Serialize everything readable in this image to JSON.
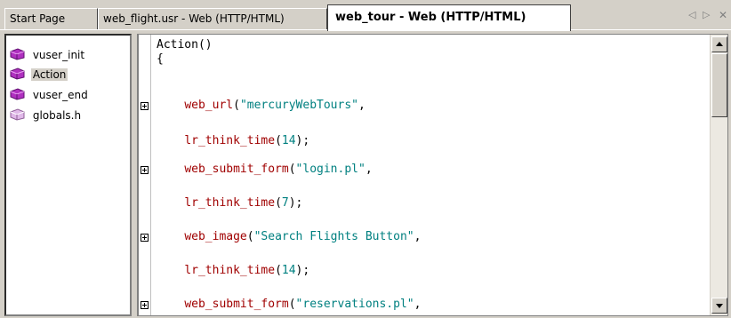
{
  "tabs": [
    {
      "label": "Start Page"
    },
    {
      "label": "web_flight.usr - Web (HTTP/HTML)"
    },
    {
      "label": "web_tour - Web (HTTP/HTML)"
    }
  ],
  "active_tab": 2,
  "nav": {
    "prev_icon": "triangle-left-icon",
    "next_icon": "triangle-right-icon",
    "close_icon": "close-icon"
  },
  "tree": {
    "items": [
      {
        "label": "vuser_init",
        "icon": "script-file-icon"
      },
      {
        "label": "Action",
        "icon": "script-file-icon",
        "selected": true
      },
      {
        "label": "vuser_end",
        "icon": "script-file-icon"
      },
      {
        "label": "globals.h",
        "icon": "header-file-icon"
      }
    ]
  },
  "editor": {
    "colors": {
      "function": "#a00000",
      "string": "#008080",
      "default": "#000000"
    },
    "lines": [
      {
        "text": "Action()"
      },
      {
        "text": "{"
      },
      {
        "fn": "web_url",
        "args": "\"mercuryWebTours\"",
        "tail": ",",
        "foldable": true
      },
      {
        "fn": "lr_think_time",
        "args": "14",
        "tail": ");",
        "foldable": false
      },
      {
        "fn": "web_submit_form",
        "args": "\"login.pl\"",
        "tail": ",",
        "foldable": true
      },
      {
        "fn": "lr_think_time",
        "args": "7",
        "tail": ");",
        "foldable": false
      },
      {
        "fn": "web_image",
        "args": "\"Search Flights Button\"",
        "tail": ",",
        "foldable": true
      },
      {
        "fn": "lr_think_time",
        "args": "14",
        "tail": ");",
        "foldable": false
      },
      {
        "fn": "web_submit_form",
        "args": "\"reservations.pl\"",
        "tail": ",",
        "foldable": true
      }
    ]
  }
}
